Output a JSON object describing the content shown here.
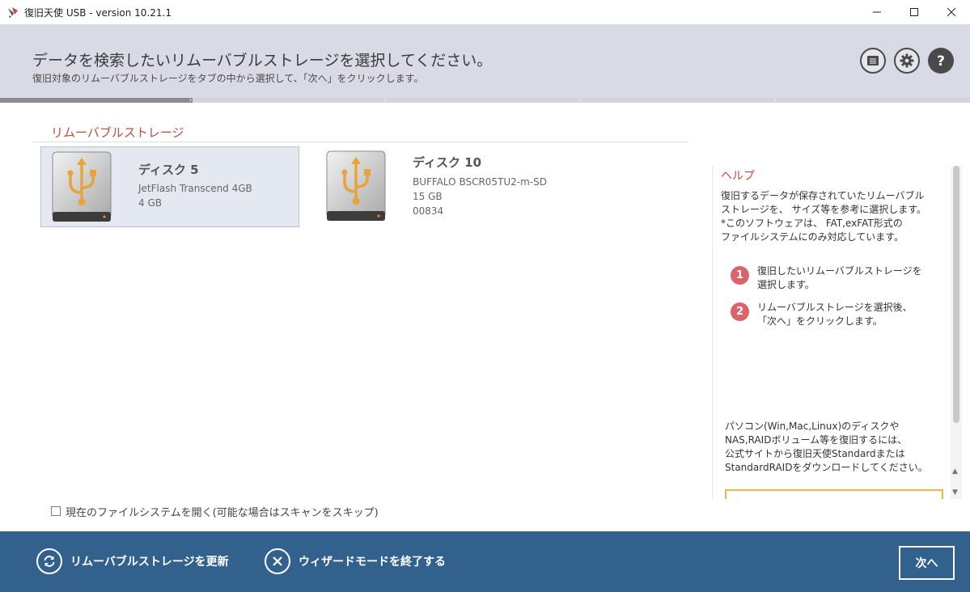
{
  "window": {
    "title": "復旧天使 USB - version 10.21.1",
    "controls": [
      "minimize-icon",
      "maximize-icon",
      "close-icon"
    ]
  },
  "header": {
    "title": "データを検索したいリムーバブルストレージを選択してください。",
    "subtitle": "復旧対象のリムーバブルストレージをタブの中から選択して、「次へ」をクリックします。",
    "icons": [
      "list-icon",
      "gear-icon",
      "help-icon"
    ]
  },
  "progress": {
    "current_step": 1,
    "total_steps": 5
  },
  "storage": {
    "section_title": "リムーバブルストレージ",
    "devices": [
      {
        "name": "ディスク 5",
        "lines": [
          "JetFlash Transcend 4GB",
          "4 GB"
        ],
        "selected": true,
        "icon": "usb-drive-icon"
      },
      {
        "name": "ディスク 10",
        "lines": [
          "BUFFALO BSCR05TU2-m-SD",
          "15 GB",
          "00834"
        ],
        "selected": false,
        "icon": "usb-drive-icon"
      }
    ]
  },
  "option": {
    "checkbox_label": "現在のファイルシステムを開く(可能な場合はスキャンをスキップ)",
    "checked": false
  },
  "help": {
    "title": "ヘルプ",
    "description": [
      "復旧するデータが保存されていたリムーバブル",
      "ストレージを、 サイズ等を参考に選択します。",
      "*このソフトウェアは、 FAT,exFAT形式の",
      "ファイルシステムにのみ対応しています。"
    ],
    "steps": [
      {
        "num": "1",
        "lines": [
          "復旧したいリムーバブルストレージを",
          "選択します。"
        ]
      },
      {
        "num": "2",
        "lines": [
          "リムーバブルストレージを選択後、",
          "「次へ」をクリックします。"
        ]
      }
    ],
    "note": [
      "パソコン(Win,Mac,Linux)のディスクや",
      "NAS,RAIDボリューム等を復旧するには、",
      "公式サイトから復旧天使Standardまたは",
      "StandardRAIDをダウンロードしてください。"
    ]
  },
  "footer": {
    "refresh_label": "リムーバブルストレージを更新",
    "exit_label": "ウィザードモードを終了する",
    "next_label": "次へ",
    "accent": "#33618d"
  },
  "colors": {
    "accent_red": "#c54a3e",
    "step_badge": "#d9646a",
    "header_bg": "#d8dbe6",
    "usb_orange": "#e8a33a"
  }
}
